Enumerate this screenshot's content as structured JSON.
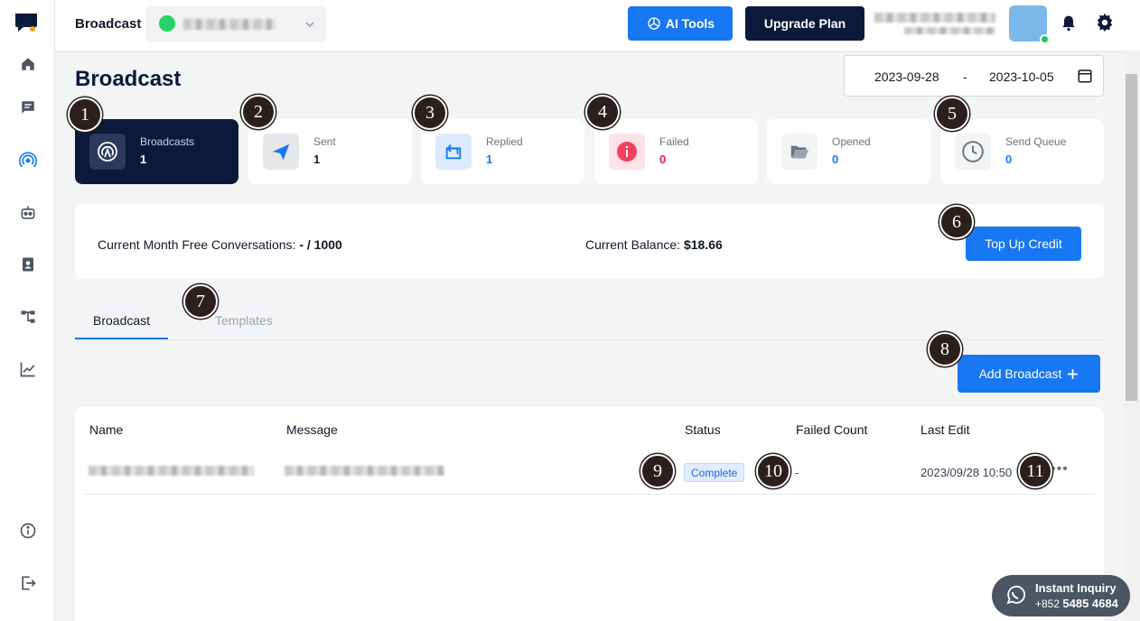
{
  "topbar": {
    "title": "Broadcast",
    "ai_tools_label": "AI Tools",
    "upgrade_label": "Upgrade Plan"
  },
  "page": {
    "title": "Broadcast",
    "date_from": "2023-09-28",
    "date_separator": "-",
    "date_to": "2023-10-05"
  },
  "stats": [
    {
      "label": "Broadcasts",
      "value": "1",
      "icon": "broadcast-icon"
    },
    {
      "label": "Sent",
      "value": "1",
      "icon": "send-icon"
    },
    {
      "label": "Replied",
      "value": "1",
      "icon": "reply-icon"
    },
    {
      "label": "Failed",
      "value": "0",
      "icon": "failed-icon"
    },
    {
      "label": "Opened",
      "value": "0",
      "icon": "folder-open-icon"
    },
    {
      "label": "Send Queue",
      "value": "0",
      "icon": "clock-icon"
    }
  ],
  "credit": {
    "free_label": "Current Month Free Conversations:",
    "free_value": "- / 1000",
    "balance_label": "Current Balance:",
    "balance_value": "$18.66",
    "topup_label": "Top Up Credit"
  },
  "tabs": [
    {
      "label": "Broadcast",
      "active": true
    },
    {
      "label": "Templates",
      "active": false
    }
  ],
  "add_broadcast_label": "Add Broadcast",
  "table": {
    "headers": [
      "Name",
      "Message",
      "Status",
      "Failed Count",
      "Last Edit"
    ],
    "rows": [
      {
        "status": "Complete",
        "failed_count": "-",
        "last_edit": "2023/09/28 10:50"
      }
    ]
  },
  "markers": [
    "1",
    "2",
    "3",
    "4",
    "5",
    "6",
    "7",
    "8",
    "9",
    "10",
    "11"
  ],
  "inquiry": {
    "title": "Instant Inquiry",
    "phone_prefix": "+852",
    "phone": "5485 4684"
  },
  "colors": {
    "primary": "#1877f2",
    "navy": "#0b1a3b",
    "failed": "#e11d48"
  }
}
